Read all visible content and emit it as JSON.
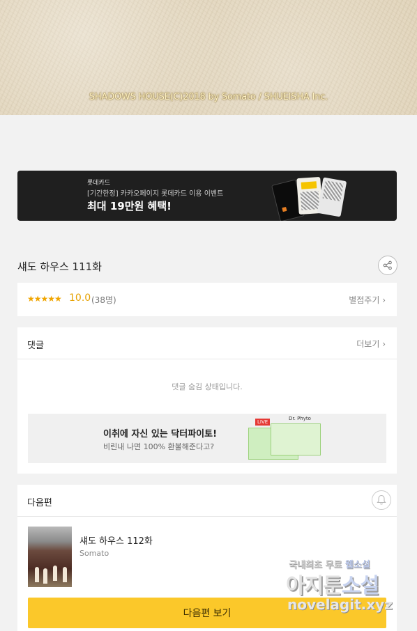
{
  "hero": {
    "copyright": "SHADOWS HOUSE(C)2018 by Somato / SHUEISHA Inc."
  },
  "banner": {
    "brand": "롯데카드",
    "subtitle": "[기간한정] 카카오페이지 롯데카드 이용 이벤트",
    "headline": "최대 19만원 혜택!"
  },
  "episode": {
    "title": "섀도 하우스 111화",
    "share_icon": "share-icon"
  },
  "rating": {
    "stars": "★★★★★",
    "score": "10.0",
    "count": "(38명)",
    "rate_link": "별점주기 ›",
    "star_color": "#f0a500"
  },
  "comments": {
    "heading": "댓글",
    "more_link": "더보기 ›",
    "hidden_message": "댓글 숨김 상태입니다."
  },
  "ad": {
    "title": "이취에 자신 있는 닥터파이토!",
    "subtitle": "비린내 나면 100% 환불해준다고?",
    "live_badge": "LIVE",
    "brand": "Dr. Phyto"
  },
  "next": {
    "heading": "다음편",
    "title": "섀도 하우스 112화",
    "author": "Somato",
    "button_label": "다음편 보기",
    "button_color": "#fbc82a",
    "bell_icon": "bell-icon"
  },
  "watermark": {
    "line1_a": "국내최초 무료 ",
    "line1_b": "웹소설",
    "line2_a": "아지툰",
    "line2_b": "소설",
    "line3": "novelagit.xyz"
  }
}
